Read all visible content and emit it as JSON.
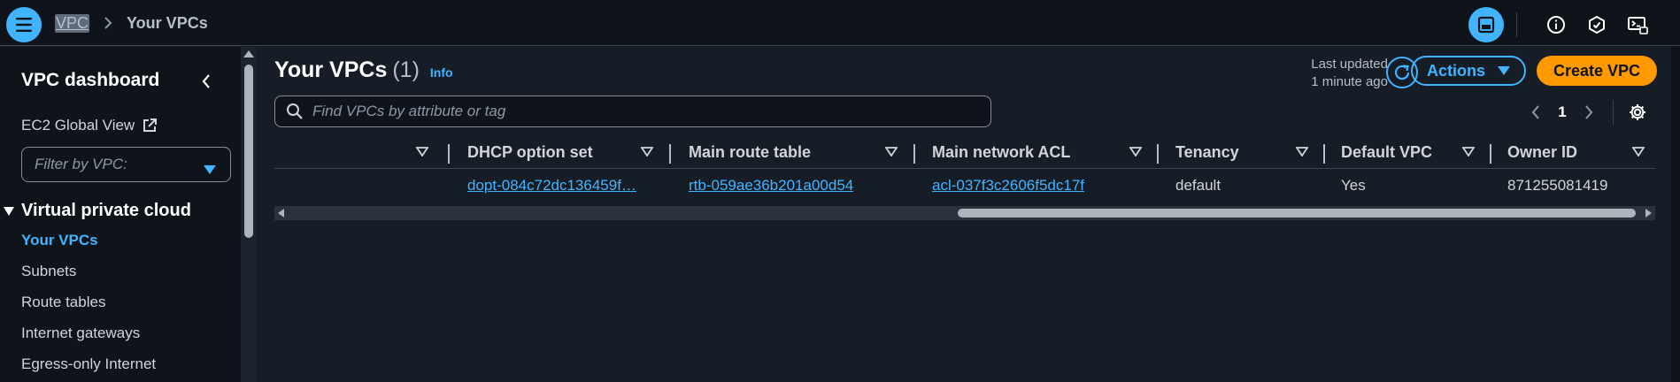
{
  "header": {
    "breadcrumb_root": "VPC",
    "breadcrumb_current": "Your VPCs",
    "icons": [
      "menu-icon",
      "split-panel-icon",
      "info-icon",
      "notifications-icon",
      "cloudshell-icon"
    ]
  },
  "sidebar": {
    "title": "VPC dashboard",
    "ec2_link": "EC2 Global View",
    "filter_placeholder": "Filter by VPC:",
    "section": "Virtual private cloud",
    "items": [
      {
        "label": "Your VPCs",
        "active": true
      },
      {
        "label": "Subnets"
      },
      {
        "label": "Route tables"
      },
      {
        "label": "Internet gateways"
      },
      {
        "label": "Egress-only Internet"
      }
    ]
  },
  "main": {
    "title": "Your VPCs",
    "count": "(1)",
    "info": "Info",
    "last_updated_line1": "Last updated",
    "last_updated_line2": "1 minute ago",
    "actions_label": "Actions",
    "create_label": "Create VPC",
    "search_placeholder": "Find VPCs by attribute or tag",
    "page": "1",
    "columns": [
      "DHCP option set",
      "Main route table",
      "Main network ACL",
      "Tenancy",
      "Default VPC",
      "Owner ID"
    ],
    "rows": [
      {
        "dhcp": "dopt-084c72dc136459f…",
        "route_table": "rtb-059ae36b201a00d54",
        "acl": "acl-037f3c2606f5dc17f",
        "tenancy": "default",
        "default_vpc": "Yes",
        "owner_id": "871255081419"
      }
    ]
  },
  "colors": {
    "background": "#161d26",
    "nav_background": "#0f141a",
    "accent": "#42b4ff",
    "primary": "#ff9900"
  }
}
